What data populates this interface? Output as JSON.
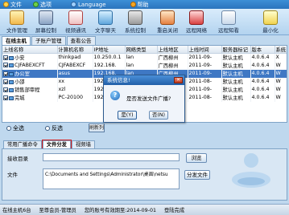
{
  "menu": [
    {
      "label": "文件",
      "icon": "folder-icon"
    },
    {
      "label": "选项",
      "icon": "options-icon"
    },
    {
      "label": "Language",
      "icon": "globe-icon"
    },
    {
      "label": "帮助",
      "icon": "help-icon"
    }
  ],
  "toolbar": [
    {
      "label": "文件管理",
      "icon": "file-manager-icon"
    },
    {
      "label": "屏幕控制",
      "icon": "screen-control-icon"
    },
    {
      "label": "视频通讯",
      "icon": "video-call-icon"
    },
    {
      "label": "文字聊天",
      "icon": "text-chat-icon"
    },
    {
      "label": "系统控制",
      "icon": "system-control-icon"
    },
    {
      "label": "重启关闭",
      "icon": "reboot-icon"
    },
    {
      "label": "远程网络",
      "icon": "remote-network-icon"
    },
    {
      "label": "远程知看",
      "icon": "notify-icon"
    },
    {
      "label": "最小化",
      "icon": "minimize-icon"
    }
  ],
  "top_tabs": [
    "在线主机",
    "子账户管理",
    "查看公告"
  ],
  "table": {
    "columns": [
      "上线名称",
      "计算机名称",
      "IP地址",
      "网络类型",
      "上线地区",
      "上线时间",
      "服务器标记",
      "版本",
      "系统"
    ],
    "rows": [
      [
        "小安",
        "thinkpad",
        "10.250.0.1",
        "lan",
        "广西柳州",
        "2011-09-",
        "默认主机",
        "4.0.6.4",
        "X"
      ],
      [
        "CJFABEXCFT",
        "CJFABEXCF",
        "192.168.",
        "lan",
        "广西柳州",
        "2011-09-",
        "默认主机",
        "4.0.6.4",
        "W"
      ],
      [
        "办公室",
        "asus",
        "192.168.",
        "lan",
        "广西柳州",
        "2011-09-",
        "默认主机",
        "4.0.6.4",
        "W"
      ],
      [
        "小邵",
        "xx",
        "192.168.",
        "lan",
        "广西柳州",
        "2011-08-",
        "默认主机",
        "4.0.6.4",
        "W"
      ],
      [
        "销售部审程",
        "xzl",
        "192.168.",
        "lan",
        "广西柳州",
        "2011-09-",
        "默认主机",
        "4.0.6.4",
        "W"
      ],
      [
        "完城",
        "PC-20100",
        "192.168.",
        "lan",
        "广西柳州",
        "2011-08-",
        "默认主机",
        "4.0.6.4",
        "W"
      ]
    ],
    "checked": [
      true,
      true,
      true,
      true,
      true,
      true
    ],
    "selected_row": 2
  },
  "selection": {
    "all": "全选",
    "invert": "反选",
    "refresh": "刷新列"
  },
  "bottom_tabs": [
    "常用广播命令",
    "文件分发",
    "视频墙"
  ],
  "panel": {
    "receive_dir_label": "接收目录",
    "receive_dir_value": "",
    "browse_button": "浏览",
    "file_label": "文件",
    "file_value": "C:\\Documents and Settings\\Administrator\\桌面\\netsu",
    "send_button": "分发文件"
  },
  "dialog": {
    "title": "系统信息!",
    "message": "是否发送文件广播?",
    "yes": "是(Y)",
    "no": "否(N)"
  },
  "status": {
    "online": "在线主机6台",
    "member": "至尊会员-管理员",
    "account_expiry": "您的账号有效期至:2014-09-01",
    "state": "登陆完成"
  }
}
